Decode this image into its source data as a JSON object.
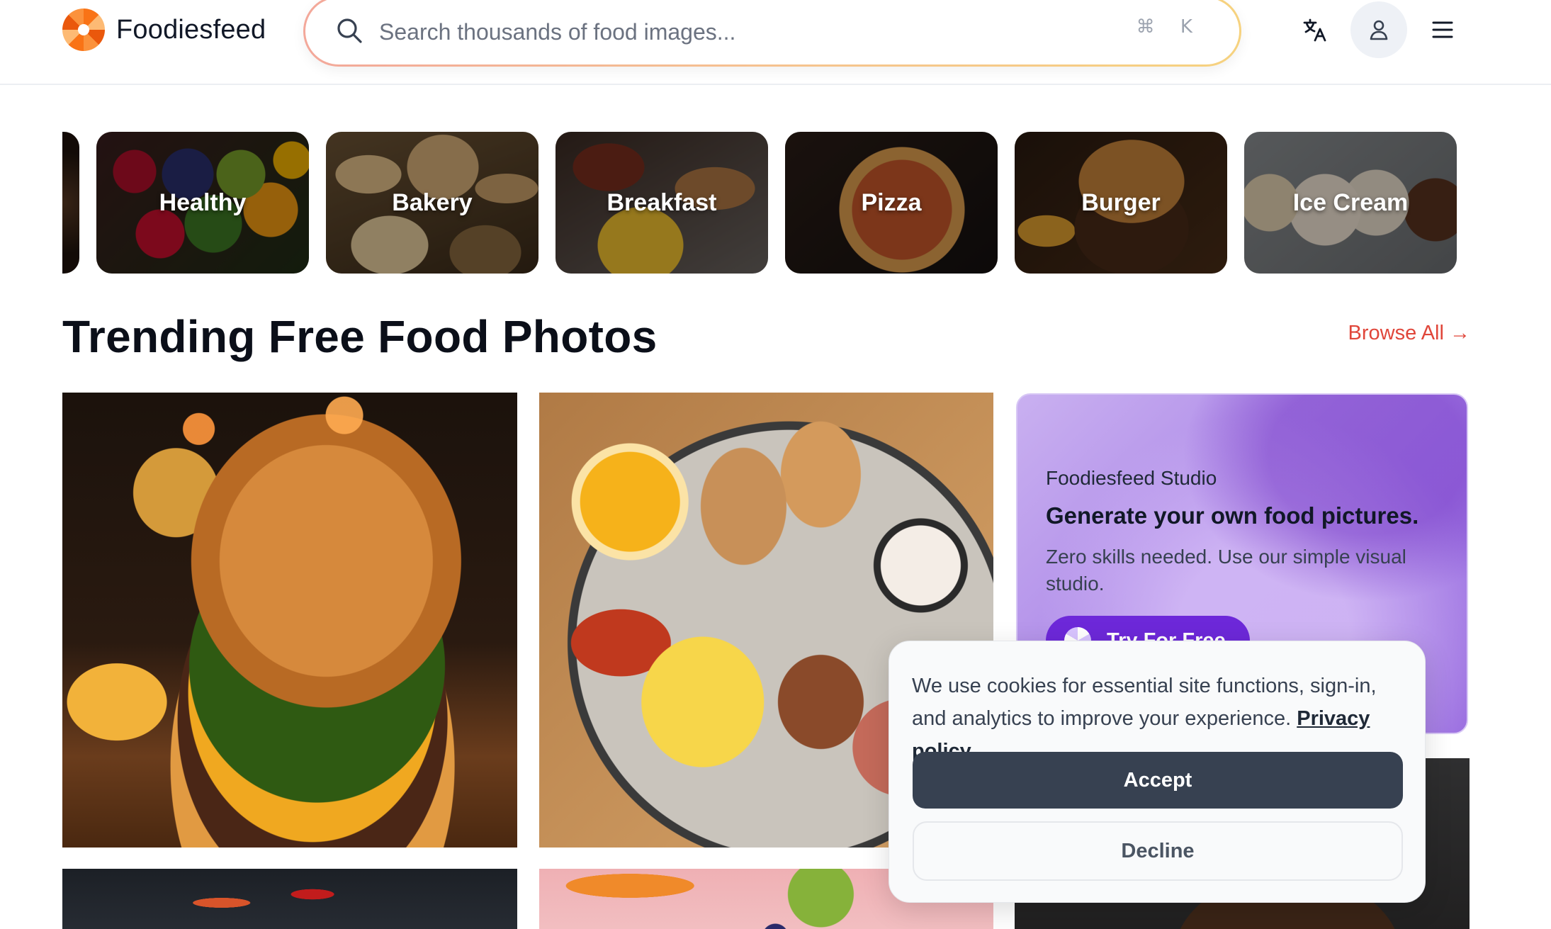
{
  "header": {
    "logo_text": "Foodiesfeed",
    "search": {
      "placeholder": "Search thousands of food images...",
      "value": "",
      "shortcut": "⌘ K"
    },
    "icons": [
      "translate-icon",
      "user-icon",
      "menu-icon"
    ]
  },
  "categories": [
    {
      "label": "Healthy"
    },
    {
      "label": "Bakery"
    },
    {
      "label": "Breakfast"
    },
    {
      "label": "Pizza"
    },
    {
      "label": "Burger"
    },
    {
      "label": "Ice Cream"
    }
  ],
  "section": {
    "title": "Trending Free Food Photos",
    "browse_all": "Browse All →"
  },
  "promo": {
    "eyebrow": "Foodiesfeed Studio",
    "title": "Generate your own food pictures.",
    "text": "Zero skills needed. Use our simple visual studio.",
    "cta": "Try For Free"
  },
  "cookie": {
    "text": "We use cookies for essential site functions, sign-in, and analytics to improve your experience.",
    "link": "Privacy policy",
    "accept": "Accept",
    "decline": "Decline"
  },
  "colors": {
    "accent": "#e0463a",
    "promo_cta": "#6d28d9",
    "accept_button": "#374151"
  }
}
